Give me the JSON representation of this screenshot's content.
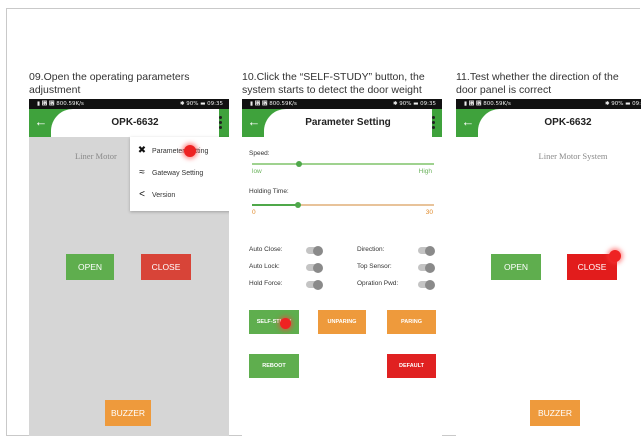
{
  "steps": [
    {
      "line1": "09.Open the operating parameters",
      "line2": "adjustment"
    },
    {
      "line1": "10.Click the “SELF-STUDY” button, the",
      "line2": "system starts to detect the door weight"
    },
    {
      "line1": "11.Test whether the direction of the",
      "line2": "door panel is correct"
    }
  ],
  "statusbar": {
    "left": "▮ ␶ ␶ 800.59K/s",
    "right_a": "✱ 90% ▬ 09:35",
    "right_b": "✱ 90% ▬ 09:"
  },
  "phone1": {
    "title": "OPK-6632",
    "system_label": "Liner Motor",
    "menu": {
      "param": "Parameter Setting",
      "gateway": "Gateway Setting",
      "version": "Version"
    },
    "open": "OPEN",
    "close": "CLOSE",
    "buzzer": "BUZZER"
  },
  "phone2": {
    "title": "Parameter Setting",
    "speed_label": "Speed:",
    "speed_low": "low",
    "speed_high": "High",
    "hold_label": "Holding Time:",
    "hold_min": "0",
    "hold_max": "30",
    "auto_close": "Auto Close:",
    "direction": "Direction:",
    "auto_lock": "Auto Lock:",
    "top_sensor": "Top Sensor:",
    "hold_force": "Hold Force:",
    "opration_pwd": "Opration Pwd:",
    "self_study": "SELF-STUDY",
    "unparing": "UNPARING",
    "paring": "PARING",
    "reboot": "REBOOT",
    "default": "DEFAULT"
  },
  "phone3": {
    "title": "OPK-6632",
    "system_label": "Liner Motor System",
    "open": "OPEN",
    "close": "CLOSE",
    "buzzer": "BUZZER"
  },
  "colors": {
    "green": "#3fa23c",
    "red": "#d84438",
    "orange": "#ee9a3c",
    "highlight": "#ee2222"
  }
}
